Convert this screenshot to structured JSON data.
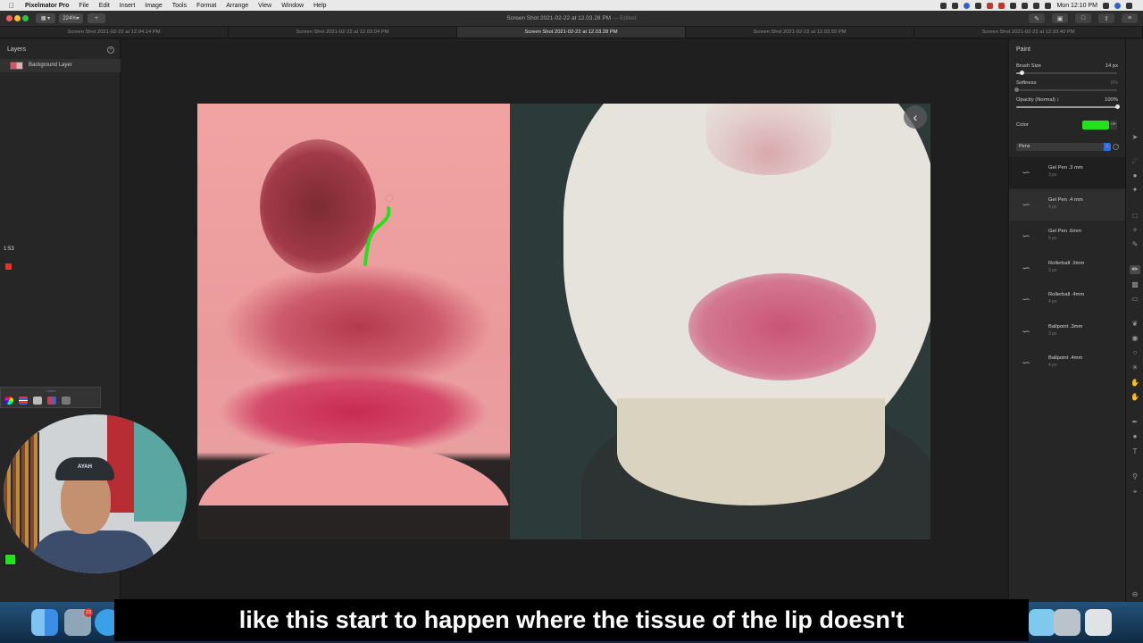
{
  "menubar": {
    "app_name": "Pixelmator Pro",
    "items": [
      "File",
      "Edit",
      "Insert",
      "Image",
      "Tools",
      "Format",
      "Arrange",
      "View",
      "Window",
      "Help"
    ],
    "clock": "Mon 12:10 PM"
  },
  "toolbar": {
    "zoom": "224%",
    "add": "+",
    "title": "Screen Shot 2021-02-22 at 12.03.28 PM",
    "title_suffix": "— Edited"
  },
  "tabs": [
    "Screen Shot 2021-02-22 at 12.04.14 PM",
    "Screen Shot 2021-02-22 at 12.03.04 PM",
    "Screen Shot 2021-02-22 at 12.03.28 PM",
    "Screen Shot 2021-02-22 at 12.03.55 PM",
    "Screen Shot 2021-02-22 at 12.03.40 PM"
  ],
  "active_tab": 2,
  "layers": {
    "title": "Layers",
    "items": [
      {
        "label": "Background Layer"
      }
    ]
  },
  "recording_timer": "1:53",
  "colors_panel_title": "Colors",
  "webcam": {
    "cap_text": "AYAH"
  },
  "dock": {
    "badge": "23"
  },
  "paint": {
    "title": "Paint",
    "brush_size": {
      "label": "Brush Size",
      "value": "14 px",
      "level": 0.05
    },
    "softness": {
      "label": "Softness",
      "value": "0%",
      "level": 0
    },
    "opacity": {
      "label": "Opacity (Normal) ↕",
      "value": "100%",
      "level": 1
    },
    "color": {
      "label": "Color",
      "value": "#22e31b"
    },
    "brush_set": "Pens",
    "brushes": [
      {
        "name": "Gel Pen .3 mm",
        "size": "3 px"
      },
      {
        "name": "Gel Pen .4 mm",
        "size": "4 px"
      },
      {
        "name": "Gel Pen .6mm",
        "size": "6 px"
      },
      {
        "name": "Rollerball .3mm",
        "size": "3 px"
      },
      {
        "name": "Rollerball .4mm",
        "size": "4 px"
      },
      {
        "name": "Ballpoint .3mm",
        "size": "3 px"
      },
      {
        "name": "Ballpoint .4mm",
        "size": "4 px"
      }
    ],
    "selected_brush": 1
  },
  "caption": "like this start to happen where the tissue of the lip doesn't",
  "colors": {
    "accent": "#2f6ddb",
    "drawing_stroke": "#22e31b",
    "record": "#e2352a"
  }
}
